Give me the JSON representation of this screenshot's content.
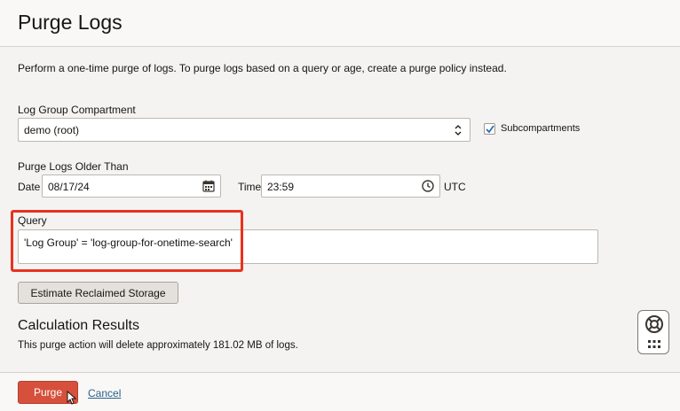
{
  "header": {
    "title": "Purge Logs"
  },
  "description": "Perform a one-time purge of logs. To purge logs based on a query or age, create a purge policy instead.",
  "compartment": {
    "label": "Log Group Compartment",
    "value": "demo (root)",
    "subcompartments_label": "Subcompartments",
    "subcompartments_checked": true
  },
  "older_than": {
    "label": "Purge Logs Older Than",
    "date_label": "Date",
    "date_value": "08/17/24",
    "time_label": "Time",
    "time_value": "23:59",
    "timezone": "UTC"
  },
  "query": {
    "label": "Query",
    "value": "'Log Group' = 'log-group-for-onetime-search'"
  },
  "estimate_button": "Estimate Reclaimed Storage",
  "results": {
    "heading": "Calculation Results",
    "text": "This purge action will delete approximately 181.02 MB of logs."
  },
  "footer": {
    "purge_label": "Purge",
    "cancel_label": "Cancel"
  },
  "colors": {
    "purge_button": "#d6503b",
    "highlight": "#e8321e",
    "checkbox_check": "#2b6ab3",
    "link": "#2b5f8a"
  },
  "icons": [
    "chevron-updown-icon",
    "check-icon",
    "calendar-icon",
    "clock-icon",
    "lifebuoy-icon",
    "grid-dots-icon",
    "cursor-icon"
  ]
}
